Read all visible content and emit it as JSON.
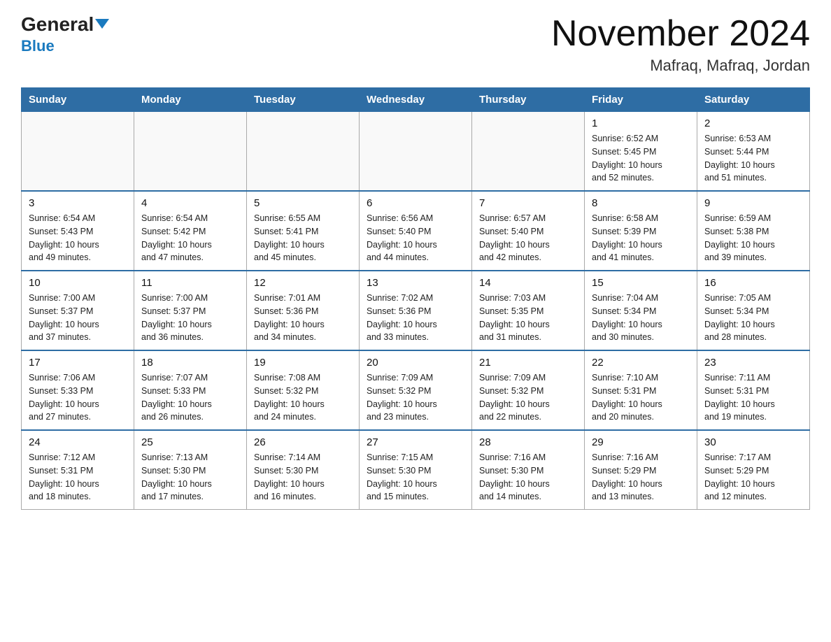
{
  "logo": {
    "name_black": "General",
    "name_blue": "Blue",
    "subtitle": "Blue"
  },
  "header": {
    "title": "November 2024",
    "location": "Mafraq, Mafraq, Jordan"
  },
  "days_of_week": [
    "Sunday",
    "Monday",
    "Tuesday",
    "Wednesday",
    "Thursday",
    "Friday",
    "Saturday"
  ],
  "weeks": [
    [
      {
        "day": "",
        "info": ""
      },
      {
        "day": "",
        "info": ""
      },
      {
        "day": "",
        "info": ""
      },
      {
        "day": "",
        "info": ""
      },
      {
        "day": "",
        "info": ""
      },
      {
        "day": "1",
        "info": "Sunrise: 6:52 AM\nSunset: 5:45 PM\nDaylight: 10 hours\nand 52 minutes."
      },
      {
        "day": "2",
        "info": "Sunrise: 6:53 AM\nSunset: 5:44 PM\nDaylight: 10 hours\nand 51 minutes."
      }
    ],
    [
      {
        "day": "3",
        "info": "Sunrise: 6:54 AM\nSunset: 5:43 PM\nDaylight: 10 hours\nand 49 minutes."
      },
      {
        "day": "4",
        "info": "Sunrise: 6:54 AM\nSunset: 5:42 PM\nDaylight: 10 hours\nand 47 minutes."
      },
      {
        "day": "5",
        "info": "Sunrise: 6:55 AM\nSunset: 5:41 PM\nDaylight: 10 hours\nand 45 minutes."
      },
      {
        "day": "6",
        "info": "Sunrise: 6:56 AM\nSunset: 5:40 PM\nDaylight: 10 hours\nand 44 minutes."
      },
      {
        "day": "7",
        "info": "Sunrise: 6:57 AM\nSunset: 5:40 PM\nDaylight: 10 hours\nand 42 minutes."
      },
      {
        "day": "8",
        "info": "Sunrise: 6:58 AM\nSunset: 5:39 PM\nDaylight: 10 hours\nand 41 minutes."
      },
      {
        "day": "9",
        "info": "Sunrise: 6:59 AM\nSunset: 5:38 PM\nDaylight: 10 hours\nand 39 minutes."
      }
    ],
    [
      {
        "day": "10",
        "info": "Sunrise: 7:00 AM\nSunset: 5:37 PM\nDaylight: 10 hours\nand 37 minutes."
      },
      {
        "day": "11",
        "info": "Sunrise: 7:00 AM\nSunset: 5:37 PM\nDaylight: 10 hours\nand 36 minutes."
      },
      {
        "day": "12",
        "info": "Sunrise: 7:01 AM\nSunset: 5:36 PM\nDaylight: 10 hours\nand 34 minutes."
      },
      {
        "day": "13",
        "info": "Sunrise: 7:02 AM\nSunset: 5:36 PM\nDaylight: 10 hours\nand 33 minutes."
      },
      {
        "day": "14",
        "info": "Sunrise: 7:03 AM\nSunset: 5:35 PM\nDaylight: 10 hours\nand 31 minutes."
      },
      {
        "day": "15",
        "info": "Sunrise: 7:04 AM\nSunset: 5:34 PM\nDaylight: 10 hours\nand 30 minutes."
      },
      {
        "day": "16",
        "info": "Sunrise: 7:05 AM\nSunset: 5:34 PM\nDaylight: 10 hours\nand 28 minutes."
      }
    ],
    [
      {
        "day": "17",
        "info": "Sunrise: 7:06 AM\nSunset: 5:33 PM\nDaylight: 10 hours\nand 27 minutes."
      },
      {
        "day": "18",
        "info": "Sunrise: 7:07 AM\nSunset: 5:33 PM\nDaylight: 10 hours\nand 26 minutes."
      },
      {
        "day": "19",
        "info": "Sunrise: 7:08 AM\nSunset: 5:32 PM\nDaylight: 10 hours\nand 24 minutes."
      },
      {
        "day": "20",
        "info": "Sunrise: 7:09 AM\nSunset: 5:32 PM\nDaylight: 10 hours\nand 23 minutes."
      },
      {
        "day": "21",
        "info": "Sunrise: 7:09 AM\nSunset: 5:32 PM\nDaylight: 10 hours\nand 22 minutes."
      },
      {
        "day": "22",
        "info": "Sunrise: 7:10 AM\nSunset: 5:31 PM\nDaylight: 10 hours\nand 20 minutes."
      },
      {
        "day": "23",
        "info": "Sunrise: 7:11 AM\nSunset: 5:31 PM\nDaylight: 10 hours\nand 19 minutes."
      }
    ],
    [
      {
        "day": "24",
        "info": "Sunrise: 7:12 AM\nSunset: 5:31 PM\nDaylight: 10 hours\nand 18 minutes."
      },
      {
        "day": "25",
        "info": "Sunrise: 7:13 AM\nSunset: 5:30 PM\nDaylight: 10 hours\nand 17 minutes."
      },
      {
        "day": "26",
        "info": "Sunrise: 7:14 AM\nSunset: 5:30 PM\nDaylight: 10 hours\nand 16 minutes."
      },
      {
        "day": "27",
        "info": "Sunrise: 7:15 AM\nSunset: 5:30 PM\nDaylight: 10 hours\nand 15 minutes."
      },
      {
        "day": "28",
        "info": "Sunrise: 7:16 AM\nSunset: 5:30 PM\nDaylight: 10 hours\nand 14 minutes."
      },
      {
        "day": "29",
        "info": "Sunrise: 7:16 AM\nSunset: 5:29 PM\nDaylight: 10 hours\nand 13 minutes."
      },
      {
        "day": "30",
        "info": "Sunrise: 7:17 AM\nSunset: 5:29 PM\nDaylight: 10 hours\nand 12 minutes."
      }
    ]
  ]
}
